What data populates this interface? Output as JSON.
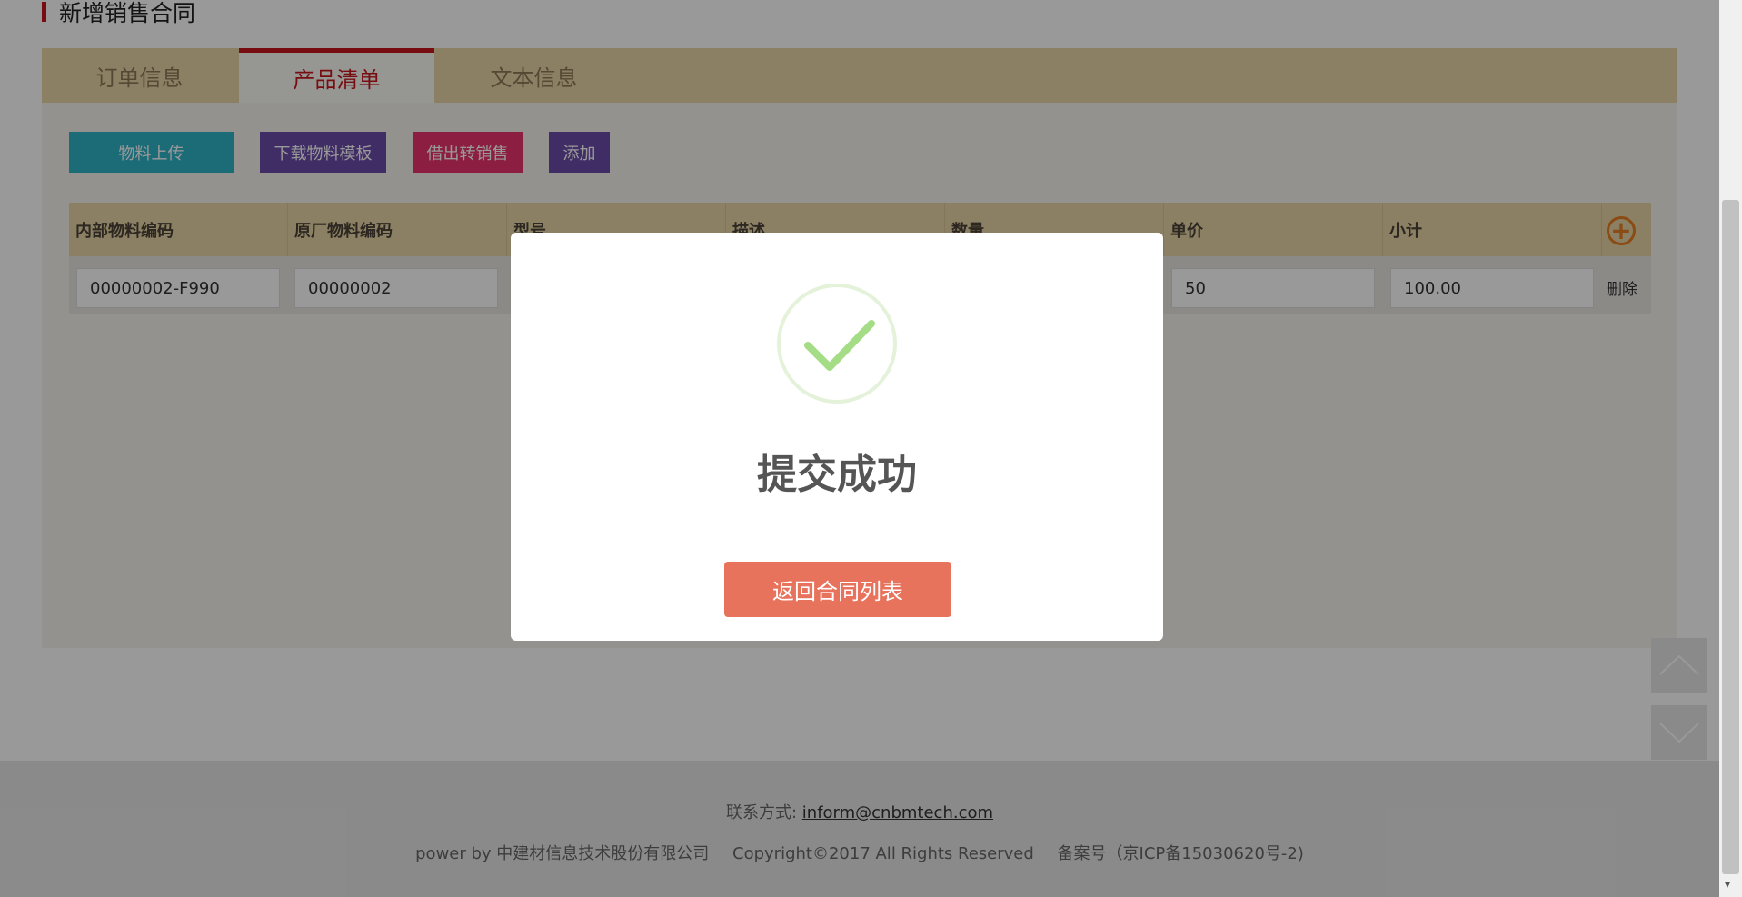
{
  "page": {
    "title": "新增销售合同"
  },
  "tabs": [
    {
      "label": "订单信息",
      "active": false
    },
    {
      "label": "产品清单",
      "active": true
    },
    {
      "label": "文本信息",
      "active": false
    }
  ],
  "toolbar": {
    "upload_label": "物料上传",
    "template_label": "下载物料模板",
    "loan_to_sale_label": "借出转销售",
    "add_label": "添加"
  },
  "table": {
    "headers": [
      "内部物料编码",
      "原厂物料编码",
      "型号",
      "描述",
      "数量",
      "单价",
      "小计"
    ],
    "add_icon": "plus-circle-icon",
    "rows": [
      {
        "internal_code": "00000002-F990",
        "vendor_code": "00000002",
        "unit_price": "50",
        "subtotal": "100.00",
        "delete_label": "删除"
      }
    ]
  },
  "side_nav": {
    "up_icon": "chevron-up-icon",
    "down_icon": "chevron-down-icon"
  },
  "footer": {
    "contact_label": "联系方式:",
    "contact_email": "inform@cnbmtech.com",
    "powered_by": "power by 中建材信息技术股份有限公司",
    "copyright": "Copyright©2017 All Rights Reserved",
    "icp": "备案号（京ICP备15030620号-2)"
  },
  "modal": {
    "icon": "success-check-icon",
    "title": "提交成功",
    "button_label": "返回合同列表"
  },
  "colors": {
    "accent_red": "#c8161d",
    "tab_bg": "#e8d6a5",
    "upload_btn": "#2fb5c9",
    "purple_btn": "#6b4ba8",
    "pink_btn": "#e8336d",
    "modal_btn": "#e8735d",
    "success_green": "#a5dc86"
  }
}
